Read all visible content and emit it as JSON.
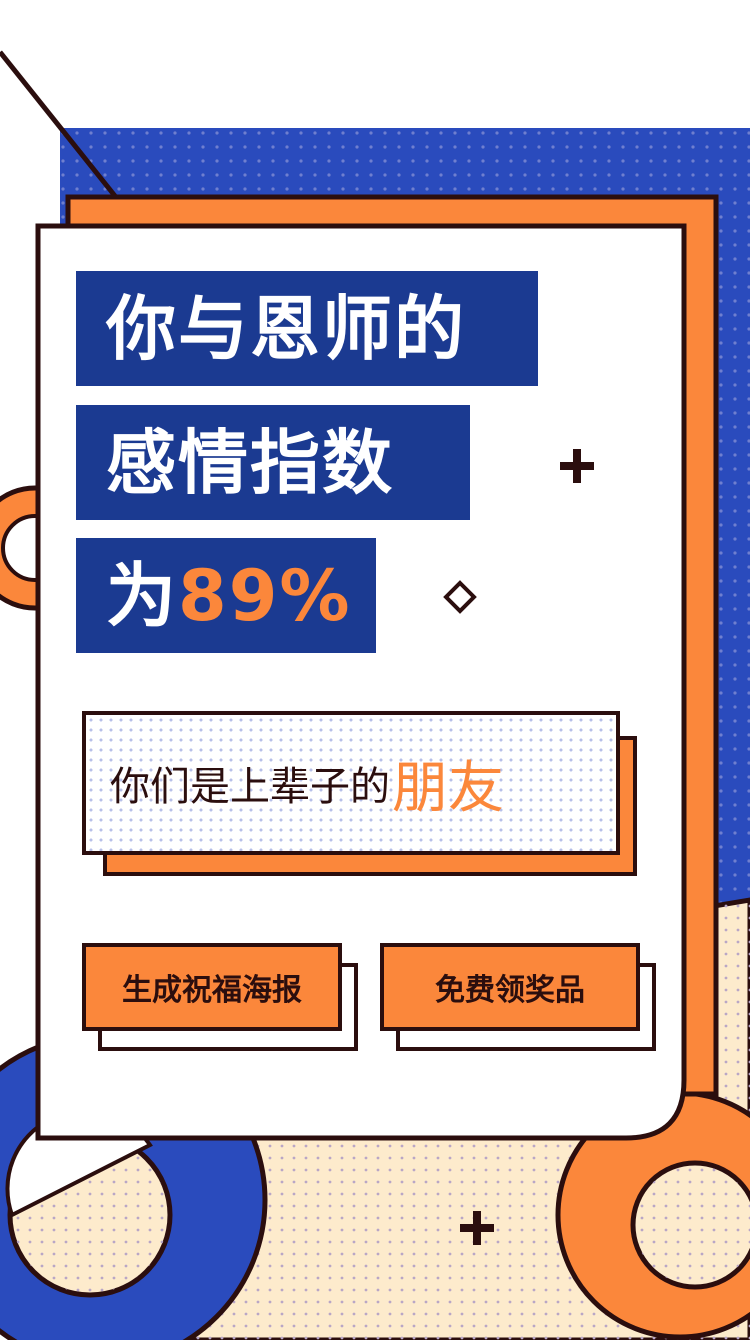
{
  "headline": {
    "line1": "你与恩师的",
    "line2": "感情指数",
    "line3_prefix": "为",
    "line3_value": "89%"
  },
  "relation": {
    "text": "你们是上辈子的",
    "highlight": "朋友"
  },
  "buttons": {
    "generate_poster": "生成祝福海报",
    "claim_prize": "免费领奖品"
  },
  "colors": {
    "navy": "#1b3a91",
    "blue": "#2a4bbd",
    "orange": "#fb873b",
    "cream": "#fdebcc",
    "outline": "#2b0e0e",
    "white": "#ffffff"
  },
  "icons": [
    "plus-sign-icon",
    "diamond-icon"
  ]
}
